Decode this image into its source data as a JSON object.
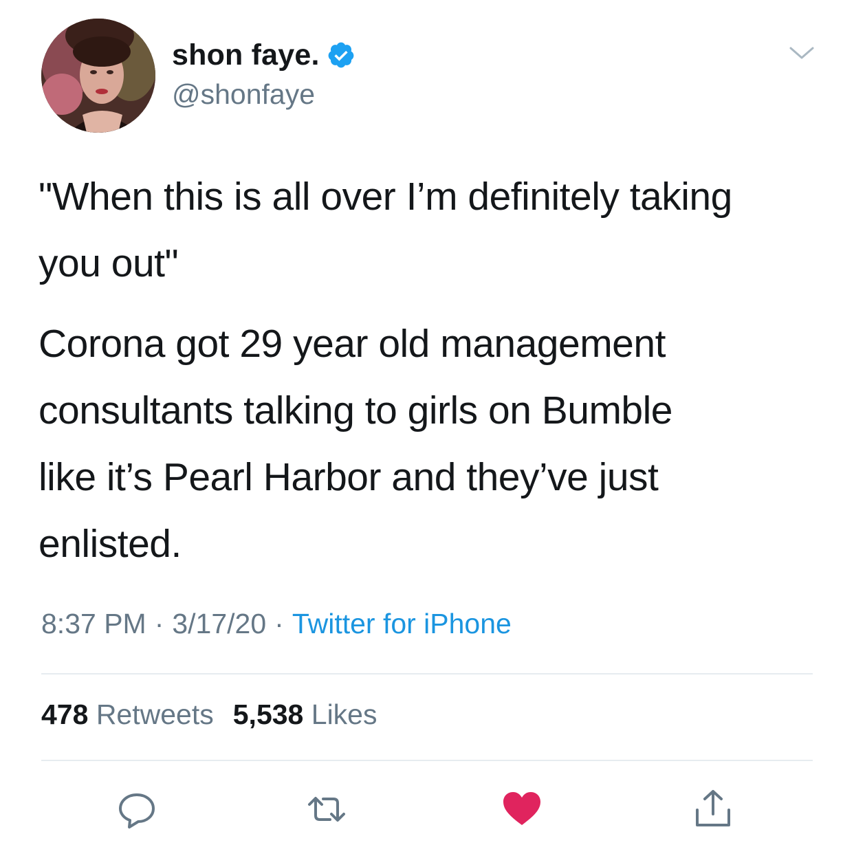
{
  "tweet": {
    "display_name": "shon faye.",
    "handle": "@shonfaye",
    "verified": true,
    "paragraphs": [
      "\"When this is all over I’m definitely taking\nyou out\"",
      "Corona got 29 year old management\nconsultants talking to girls on Bumble\nlike it’s Pearl Harbor and they’ve just\nenlisted."
    ],
    "time": "8:37 PM",
    "date": "3/17/20",
    "separator": "·",
    "source": "Twitter for iPhone"
  },
  "stats": {
    "retweets_count": "478",
    "retweets_label": "Retweets",
    "likes_count": "5,538",
    "likes_label": "Likes"
  },
  "actions": {
    "icons": [
      "reply-icon",
      "retweet-icon",
      "like-icon",
      "share-icon"
    ],
    "liked": true
  },
  "colors": {
    "text": "#14171a",
    "secondary": "#657786",
    "link": "#1b95e0",
    "verified": "#1da1f2",
    "like": "#e0245e",
    "divider": "#e6ecf0"
  }
}
